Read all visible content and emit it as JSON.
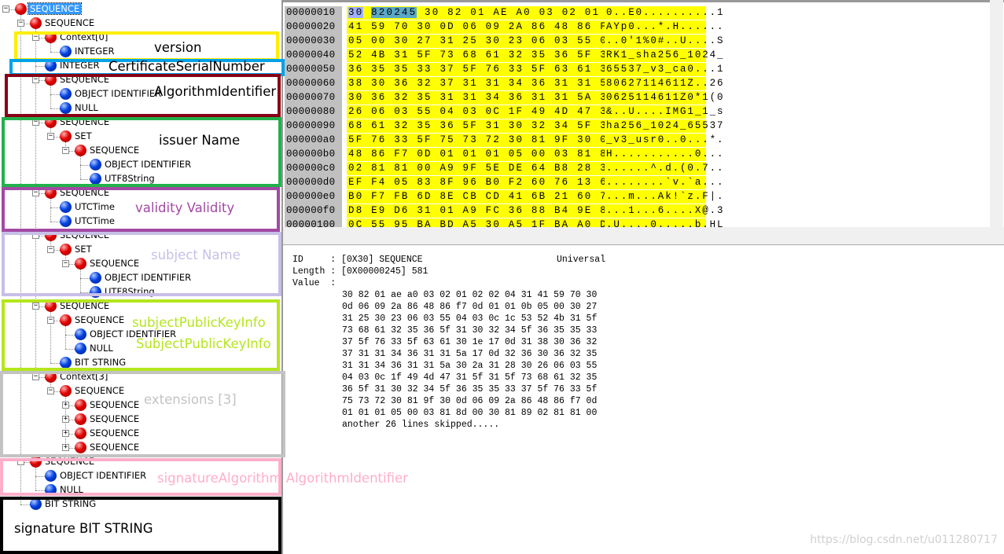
{
  "tree": [
    {
      "label": "SEQUENCE",
      "level": 0,
      "type": "constructed",
      "toggle": "minus",
      "selected": true
    },
    {
      "label": "SEQUENCE",
      "level": 1,
      "type": "constructed",
      "toggle": "minus"
    },
    {
      "label": "Context[0]",
      "level": 2,
      "type": "constructed",
      "toggle": "minus"
    },
    {
      "label": "INTEGER",
      "level": 3,
      "type": "primitive"
    },
    {
      "label": "INTEGER",
      "level": 2,
      "type": "primitive"
    },
    {
      "label": "SEQUENCE",
      "level": 2,
      "type": "constructed",
      "toggle": "minus"
    },
    {
      "label": "OBJECT IDENTIFIER",
      "level": 3,
      "type": "primitive"
    },
    {
      "label": "NULL",
      "level": 3,
      "type": "primitive"
    },
    {
      "label": "SEQUENCE",
      "level": 2,
      "type": "constructed",
      "toggle": "minus"
    },
    {
      "label": "SET",
      "level": 3,
      "type": "constructed",
      "toggle": "minus"
    },
    {
      "label": "SEQUENCE",
      "level": 4,
      "type": "constructed",
      "toggle": "minus"
    },
    {
      "label": "OBJECT IDENTIFIER",
      "level": 5,
      "type": "primitive"
    },
    {
      "label": "UTF8String",
      "level": 5,
      "type": "primitive"
    },
    {
      "label": "SEQUENCE",
      "level": 2,
      "type": "constructed",
      "toggle": "minus"
    },
    {
      "label": "UTCTime",
      "level": 3,
      "type": "primitive"
    },
    {
      "label": "UTCTime",
      "level": 3,
      "type": "primitive"
    },
    {
      "label": "SEQUENCE",
      "level": 2,
      "type": "constructed",
      "toggle": "minus"
    },
    {
      "label": "SET",
      "level": 3,
      "type": "constructed",
      "toggle": "minus"
    },
    {
      "label": "SEQUENCE",
      "level": 4,
      "type": "constructed",
      "toggle": "minus"
    },
    {
      "label": "OBJECT IDENTIFIER",
      "level": 5,
      "type": "primitive"
    },
    {
      "label": "UTF8String",
      "level": 5,
      "type": "primitive"
    },
    {
      "label": "SEQUENCE",
      "level": 2,
      "type": "constructed",
      "toggle": "minus"
    },
    {
      "label": "SEQUENCE",
      "level": 3,
      "type": "constructed",
      "toggle": "minus"
    },
    {
      "label": "OBJECT IDENTIFIER",
      "level": 4,
      "type": "primitive"
    },
    {
      "label": "NULL",
      "level": 4,
      "type": "primitive"
    },
    {
      "label": "BIT STRING",
      "level": 3,
      "type": "primitive"
    },
    {
      "label": "Context[3]",
      "level": 2,
      "type": "constructed",
      "toggle": "minus"
    },
    {
      "label": "SEQUENCE",
      "level": 3,
      "type": "constructed",
      "toggle": "minus"
    },
    {
      "label": "SEQUENCE",
      "level": 4,
      "type": "constructed",
      "toggle": "plus"
    },
    {
      "label": "SEQUENCE",
      "level": 4,
      "type": "constructed",
      "toggle": "plus"
    },
    {
      "label": "SEQUENCE",
      "level": 4,
      "type": "constructed",
      "toggle": "plus"
    },
    {
      "label": "SEQUENCE",
      "level": 4,
      "type": "constructed",
      "toggle": "plus"
    },
    {
      "label": "SEQUENCE",
      "level": 1,
      "type": "constructed",
      "toggle": "minus"
    },
    {
      "label": "OBJECT IDENTIFIER",
      "level": 2,
      "type": "primitive"
    },
    {
      "label": "NULL",
      "level": 2,
      "type": "primitive"
    },
    {
      "label": "BIT STRING",
      "level": 1,
      "type": "primitive"
    }
  ],
  "annotations": [
    {
      "label": "version",
      "color": "#ffee00",
      "text_color": "#000000"
    },
    {
      "label": "CertificateSerialNumber",
      "color": "#00a2e8",
      "text_color": "#000000"
    },
    {
      "label": "AlgorithmIdentifier",
      "color": "#880015",
      "text_color": "#000000"
    },
    {
      "label": "issuer Name",
      "color": "#22b14c",
      "text_color": "#000000"
    },
    {
      "label": "validity Validity",
      "color": "#a349a4",
      "text_color": "#a349a4"
    },
    {
      "label": "subject Name",
      "color": "#c8bfe7",
      "text_color": "#c8bfe7"
    },
    {
      "label": "subjectPublicKeyInfo",
      "label2": "SubjectPublicKeyInfo",
      "color": "#b5e61d",
      "text_color": "#b5e61d"
    },
    {
      "label": "extensions [3]",
      "color": "#c3c3c3",
      "text_color": "#c3c3c3"
    },
    {
      "label": "signatureAlgorithm AlgorithmIdentifier",
      "color": "#ffaec9",
      "text_color": "#ffaec9"
    },
    {
      "label": "signature BIT STRING",
      "color": "#000000",
      "text_color": "#000000"
    }
  ],
  "hex": {
    "rows": [
      {
        "addr": "00000010 :",
        "bytes": [
          "30",
          "82",
          "02",
          "45",
          "30",
          "82",
          "01",
          "AE",
          "A0",
          "03",
          "02",
          "01",
          "02",
          "02",
          "04",
          "31"
        ],
        "ascii": "0..E0..........1"
      },
      {
        "addr": "00000020 :",
        "bytes": [
          "41",
          "59",
          "70",
          "30",
          "0D",
          "06",
          "09",
          "2A",
          "86",
          "48",
          "86",
          "F7",
          "0D",
          "01",
          "01",
          "0B"
        ],
        "ascii": "AYp0...*.H......"
      },
      {
        "addr": "00000030 :",
        "bytes": [
          "05",
          "00",
          "30",
          "27",
          "31",
          "25",
          "30",
          "23",
          "06",
          "03",
          "55",
          "04",
          "03",
          "0C",
          "1C",
          "53"
        ],
        "ascii": "..0'1%0#..U....S"
      },
      {
        "addr": "00000040 :",
        "bytes": [
          "52",
          "4B",
          "31",
          "5F",
          "73",
          "68",
          "61",
          "32",
          "35",
          "36",
          "5F",
          "31",
          "30",
          "32",
          "34",
          "5F"
        ],
        "ascii": "RK1_sha256_1024_"
      },
      {
        "addr": "00000050 :",
        "bytes": [
          "36",
          "35",
          "35",
          "33",
          "37",
          "5F",
          "76",
          "33",
          "5F",
          "63",
          "61",
          "30",
          "1E",
          "17",
          "0D",
          "31"
        ],
        "ascii": "65537_v3_ca0...1"
      },
      {
        "addr": "00000060 :",
        "bytes": [
          "38",
          "30",
          "36",
          "32",
          "37",
          "31",
          "31",
          "34",
          "36",
          "31",
          "31",
          "5A",
          "17",
          "0D",
          "32",
          "36"
        ],
        "ascii": "80627114611Z..26"
      },
      {
        "addr": "00000070 :",
        "bytes": [
          "30",
          "36",
          "32",
          "35",
          "31",
          "31",
          "34",
          "36",
          "31",
          "31",
          "5A",
          "30",
          "2A",
          "31",
          "28",
          "30"
        ],
        "ascii": "0625114611Z0*1(0"
      },
      {
        "addr": "00000080 :",
        "bytes": [
          "26",
          "06",
          "03",
          "55",
          "04",
          "03",
          "0C",
          "1F",
          "49",
          "4D",
          "47",
          "31",
          "5F",
          "31",
          "5F",
          "73"
        ],
        "ascii": "&..U....IMG1_1_s"
      },
      {
        "addr": "00000090 :",
        "bytes": [
          "68",
          "61",
          "32",
          "35",
          "36",
          "5F",
          "31",
          "30",
          "32",
          "34",
          "5F",
          "36",
          "35",
          "35",
          "33",
          "37"
        ],
        "ascii": "ha256_1024_65537"
      },
      {
        "addr": "000000a0 :",
        "bytes": [
          "5F",
          "76",
          "33",
          "5F",
          "75",
          "73",
          "72",
          "30",
          "81",
          "9F",
          "30",
          "0D",
          "06",
          "09",
          "2A",
          "86"
        ],
        "ascii": "_v3_usr0..0...*."
      },
      {
        "addr": "000000b0 :",
        "bytes": [
          "48",
          "86",
          "F7",
          "0D",
          "01",
          "01",
          "01",
          "05",
          "00",
          "03",
          "81",
          "8D",
          "00",
          "30",
          "81",
          "89"
        ],
        "ascii": "H...........0..."
      },
      {
        "addr": "000000c0 :",
        "bytes": [
          "02",
          "81",
          "81",
          "00",
          "A9",
          "9F",
          "5E",
          "DE",
          "64",
          "B8",
          "28",
          "30",
          "BE",
          "37",
          "07",
          "E3"
        ],
        "ascii": "......^.d.(0.7.."
      },
      {
        "addr": "000000d0 :",
        "bytes": [
          "EF",
          "F4",
          "05",
          "83",
          "8F",
          "96",
          "B0",
          "F2",
          "60",
          "76",
          "13",
          "60",
          "61",
          "84",
          "E6",
          "06"
        ],
        "ascii": "........`v.`a..."
      },
      {
        "addr": "000000e0 :",
        "bytes": [
          "B0",
          "F7",
          "FB",
          "6D",
          "8E",
          "CB",
          "CD",
          "41",
          "6B",
          "21",
          "60",
          "7A",
          "94",
          "46",
          "7C",
          "99"
        ],
        "ascii": "...m...Ak!`z.F|."
      },
      {
        "addr": "000000f0 :",
        "bytes": [
          "D8",
          "E9",
          "D6",
          "31",
          "01",
          "A9",
          "FC",
          "36",
          "88",
          "B4",
          "9E",
          "85",
          "58",
          "40",
          "D1",
          "33"
        ],
        "ascii": "...1...6....X@.3"
      },
      {
        "addr": "00000100 :",
        "bytes": [
          "0C",
          "55",
          "95",
          "BA",
          "BD",
          "A5",
          "30",
          "A5",
          "1F",
          "BA",
          "A0",
          "D0",
          "62",
          "A1",
          "48",
          "4C"
        ],
        "ascii": ".U....0.....b.HL"
      },
      {
        "addr": "00000110 :",
        "bytes": [
          "83",
          "E0",
          "75",
          "B2",
          "51",
          "55",
          "11",
          "B6",
          "27",
          "1F",
          "8A",
          "1C",
          "D8",
          "80",
          "15",
          "0F"
        ],
        "ascii": "..u.QU..'......."
      }
    ]
  },
  "info": {
    "id_label": "ID     :",
    "id_value": "[0X30] SEQUENCE",
    "class": "Universal",
    "length_label": "Length :",
    "length_value": "[0X00000245] 581",
    "value_label": "Value  :",
    "value_lines": [
      "30 82 01 ae a0 03 02 01 02 02 04 31 41 59 70 30",
      "0d 06 09 2a 86 48 86 f7 0d 01 01 0b 05 00 30 27",
      "31 25 30 23 06 03 55 04 03 0c 1c 53 52 4b 31 5f",
      "73 68 61 32 35 36 5f 31 30 32 34 5f 36 35 35 33",
      "37 5f 76 33 5f 63 61 30 1e 17 0d 31 38 30 36 32",
      "37 31 31 34 36 31 31 5a 17 0d 32 36 30 36 32 35",
      "31 31 34 36 31 31 5a 30 2a 31 28 30 26 06 03 55",
      "04 03 0c 1f 49 4d 47 31 5f 31 5f 73 68 61 32 35",
      "36 5f 31 30 32 34 5f 36 35 35 33 37 5f 76 33 5f",
      "75 73 72 30 81 9f 30 0d 06 09 2a 86 48 86 f7 0d",
      "01 01 01 05 00 03 81 8d 00 30 81 89 02 81 81 00"
    ],
    "skipped": "another 26 lines skipped....."
  },
  "watermark": "https://blog.csdn.net/u011280717"
}
